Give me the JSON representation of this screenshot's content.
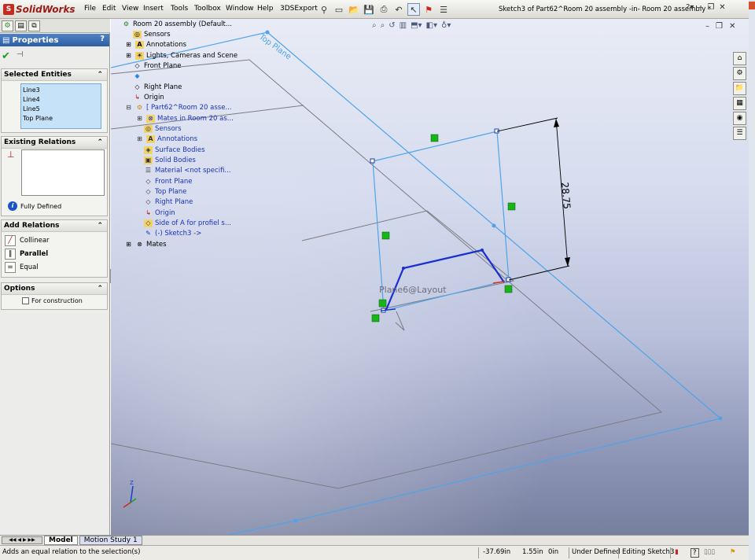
{
  "app": {
    "name": "SolidWorks",
    "document_title": "Sketch3 of Part62^Room 20 assembly -in- Room 20 assembly *"
  },
  "menu": [
    "File",
    "Edit",
    "View",
    "Insert",
    "Tools",
    "Toolbox",
    "Window",
    "Help",
    "3DSExport"
  ],
  "property_manager": {
    "title": "Properties",
    "help": "?",
    "selected_entities": {
      "label": "Selected Entities",
      "items": [
        "Line3",
        "Line4",
        "Line5",
        "Top Plane"
      ]
    },
    "existing_relations": {
      "label": "Existing Relations",
      "status": "Fully Defined"
    },
    "add_relations": {
      "label": "Add Relations",
      "items": [
        "Collinear",
        "Parallel",
        "Equal"
      ]
    },
    "options": {
      "label": "Options",
      "for_construction": "For construction"
    }
  },
  "tree": {
    "root": "Room 20 assembly  (Default...",
    "items": [
      {
        "label": "Sensors",
        "indent": 1,
        "color": "black"
      },
      {
        "label": "Annotations",
        "indent": 1,
        "color": "black"
      },
      {
        "label": "Lights, Cameras and Scene",
        "indent": 1,
        "color": "black"
      },
      {
        "label": "Front Plane",
        "indent": 1,
        "color": "black"
      },
      {
        "label": "",
        "indent": 1,
        "color": "black"
      },
      {
        "label": "Right Plane",
        "indent": 1,
        "color": "black"
      },
      {
        "label": "Origin",
        "indent": 1,
        "color": "black"
      },
      {
        "label": "[ Part62^Room 20 asse...",
        "indent": 1,
        "color": "blue"
      },
      {
        "label": "Mates in Room 20 as...",
        "indent": 2,
        "color": "blue"
      },
      {
        "label": "Sensors",
        "indent": 2,
        "color": "blue"
      },
      {
        "label": "Annotations",
        "indent": 2,
        "color": "blue"
      },
      {
        "label": "Surface Bodies",
        "indent": 2,
        "color": "blue"
      },
      {
        "label": "Solid Bodies",
        "indent": 2,
        "color": "blue"
      },
      {
        "label": "Material <not specifi...",
        "indent": 2,
        "color": "blue"
      },
      {
        "label": "Front Plane",
        "indent": 2,
        "color": "blue"
      },
      {
        "label": "Top Plane",
        "indent": 2,
        "color": "blue"
      },
      {
        "label": "Right Plane",
        "indent": 2,
        "color": "blue"
      },
      {
        "label": "Origin",
        "indent": 2,
        "color": "blue"
      },
      {
        "label": "Side of A for profiel s...",
        "indent": 2,
        "color": "blue"
      },
      {
        "label": "(-) Sketch3 ->",
        "indent": 2,
        "color": "blue"
      },
      {
        "label": "Mates",
        "indent": 1,
        "color": "black"
      }
    ]
  },
  "viewport": {
    "top_plane_label": "Top Plane",
    "plane_label": "Plane6@Layout",
    "dimension": "28.75"
  },
  "tabs": [
    "Model",
    "Motion Study 1"
  ],
  "status": {
    "message": "Adds an equal relation to the selection(s)",
    "x": "-37.69in",
    "y": "1.55in",
    "z": "0in",
    "state": "Under Defined",
    "editing": "Editing Sketch3",
    "help": "?"
  },
  "colors": {
    "accent": "#2d5ea4",
    "sketch": "#1a2fd0",
    "plane": "#4fa3ea",
    "relation": "#17b517"
  }
}
